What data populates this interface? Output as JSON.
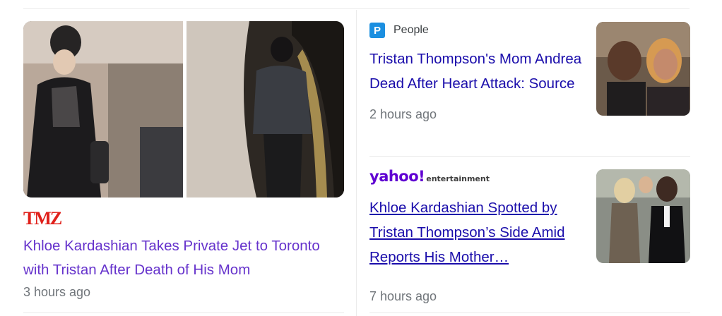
{
  "main_story": {
    "source_logo_text": "TMZ",
    "title": "Khloe Kardashian Takes Private Jet to Toronto with Tristan After Death of His Mom",
    "time": "3 hours ago"
  },
  "side_stories": [
    {
      "source": "People",
      "source_icon_letter": "P",
      "title": "Tristan Thompson's Mom Andrea Dead After Heart Attack: Source",
      "time": "2 hours ago"
    },
    {
      "source_logo_main": "yahoo!",
      "source_logo_sub": "entertainment",
      "title": "Khloe Kardashian Spotted by Tristan Thompson’s Side Amid Reports His Mother…",
      "time": "7 hours ago"
    }
  ],
  "colors": {
    "visited_link": "#6633cc",
    "link": "#1a0dab",
    "meta_text": "#70757a",
    "tmz_red": "#e0211b",
    "yahoo_purple": "#6001d2",
    "people_blue": "#1b8fe0"
  }
}
